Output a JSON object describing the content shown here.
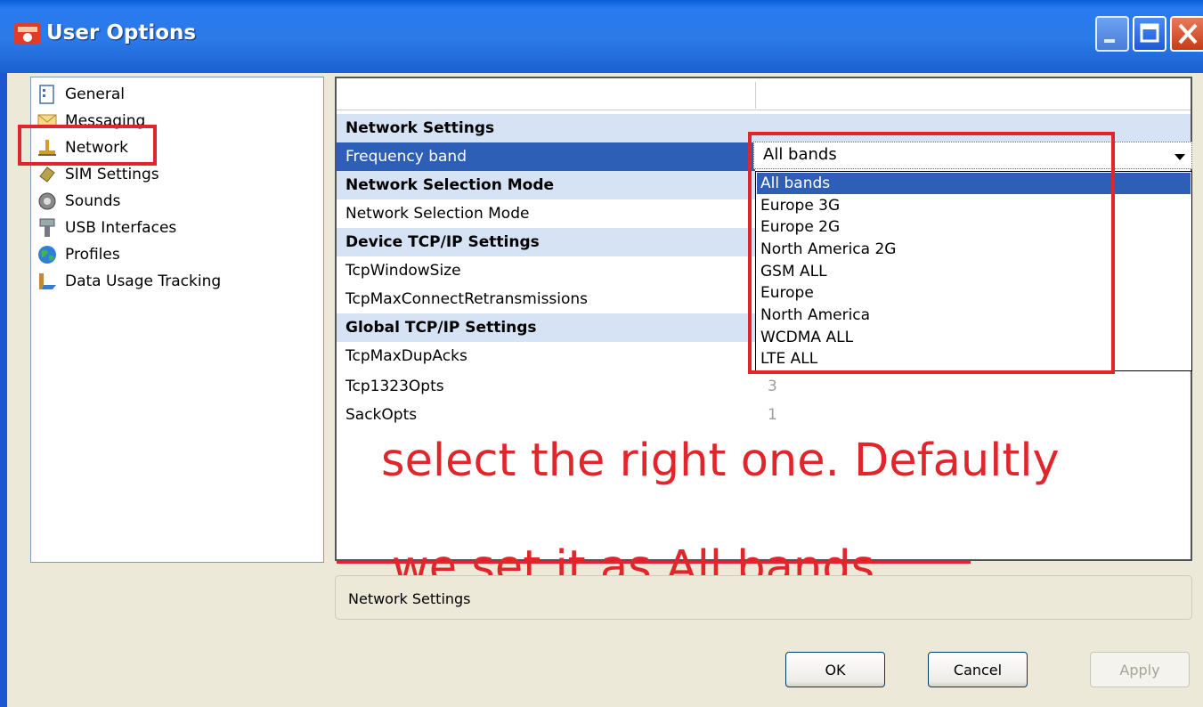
{
  "window": {
    "title": "User Options",
    "icon": "app-icon"
  },
  "nav": {
    "items": [
      {
        "label": "General",
        "icon": "general-icon"
      },
      {
        "label": "Messaging",
        "icon": "envelope-icon"
      },
      {
        "label": "Network",
        "icon": "network-icon"
      },
      {
        "label": "SIM Settings",
        "icon": "sim-card-icon"
      },
      {
        "label": "Sounds",
        "icon": "speaker-icon"
      },
      {
        "label": "USB Interfaces",
        "icon": "usb-icon"
      },
      {
        "label": "Profiles",
        "icon": "globe-icon"
      },
      {
        "label": "Data Usage Tracking",
        "icon": "data-usage-icon"
      }
    ],
    "selected": "Network"
  },
  "grid": {
    "rows": [
      {
        "name": "Network Settings",
        "type": "category"
      },
      {
        "name": "Frequency band",
        "type": "selected",
        "value": "All bands"
      },
      {
        "name": "Network Selection Mode",
        "type": "category"
      },
      {
        "name": "Network Selection Mode",
        "type": "property"
      },
      {
        "name": "Device TCP/IP Settings",
        "type": "category"
      },
      {
        "name": "TcpWindowSize",
        "type": "property"
      },
      {
        "name": "TcpMaxConnectRetransmissions",
        "type": "property"
      },
      {
        "name": "Global TCP/IP Settings",
        "type": "category"
      },
      {
        "name": "TcpMaxDupAcks",
        "type": "property"
      },
      {
        "name": "Tcp1323Opts",
        "type": "property",
        "value": "3"
      },
      {
        "name": "SackOpts",
        "type": "property",
        "value": "1"
      }
    ],
    "combo_value": "All bands",
    "dropdown_options": [
      "All bands",
      "Europe 3G",
      "Europe 2G",
      "North America 2G",
      "GSM ALL",
      "Europe",
      "North America",
      "WCDMA ALL",
      "LTE ALL"
    ],
    "dropdown_selected": "All bands"
  },
  "annotation": {
    "line1": "select the right one. Defaultly",
    "line2": "we set it as All bands"
  },
  "description": "Network Settings",
  "buttons": {
    "ok": "OK",
    "cancel": "Cancel",
    "apply": "Apply"
  },
  "colors": {
    "annotation": "#e0262b",
    "selection": "#2d5fb7",
    "titlebar": "#2b7ae8"
  }
}
